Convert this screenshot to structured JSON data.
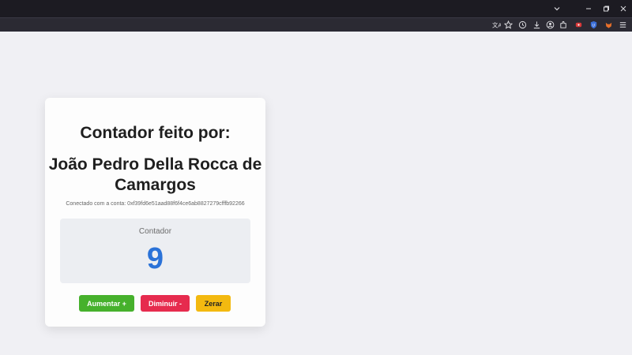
{
  "browser": {
    "titlebar": {
      "tab_list_icon": "chevron-down-icon",
      "minimize_glyph": "—",
      "restore_glyph": "❐",
      "close_glyph": "✕"
    },
    "toolbar_icons": [
      "translate-icon",
      "bookmark-star-icon",
      "history-icon",
      "download-icon",
      "account-icon",
      "extensions-icon",
      "extension-red-icon",
      "extension-shield-icon",
      "extension-fox-icon",
      "menu-icon"
    ]
  },
  "page": {
    "heading": "Contador feito por:",
    "author_line1": "João Pedro Della Rocca de",
    "author_line2": "Camargos",
    "account_text": "Conectado com a conta: 0xf39fd6e51aad88f6f4ce6ab8827279cfffb92266",
    "counter": {
      "label": "Contador",
      "value": "9"
    },
    "buttons": {
      "increment": "Aumentar +",
      "decrement": "Diminuir -",
      "reset": "Zerar"
    }
  },
  "colors": {
    "increment": "#46b12c",
    "decrement": "#e62b4e",
    "reset": "#f3b910",
    "counter_value": "#2a72d8"
  }
}
